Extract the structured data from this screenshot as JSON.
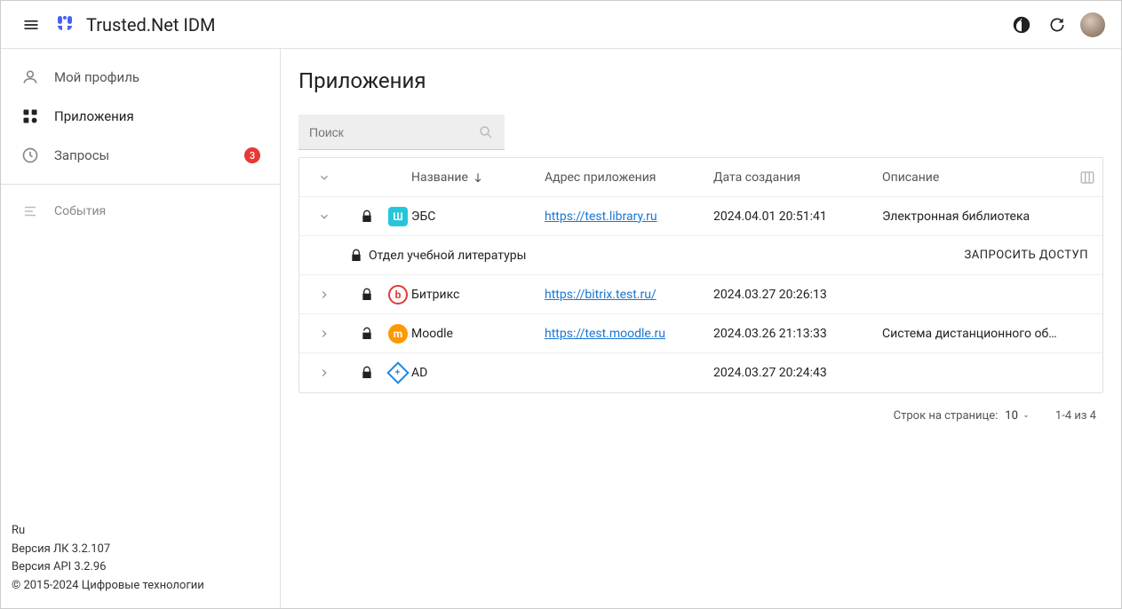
{
  "header": {
    "app_title": "Trusted.Net IDM"
  },
  "sidebar": {
    "items": [
      {
        "icon": "user-icon",
        "label": "Мой профиль"
      },
      {
        "icon": "apps-icon",
        "label": "Приложения",
        "active": true
      },
      {
        "icon": "clock-icon",
        "label": "Запросы",
        "badge": "3"
      }
    ],
    "events_label": "События",
    "footer": {
      "lang": "Ru",
      "version_lk": "Версия ЛК 3.2.107",
      "version_api": "Версия API 3.2.96",
      "copyright": "© 2015-2024 Цифровые технологии"
    }
  },
  "main": {
    "title": "Приложения",
    "search_placeholder": "Поиск",
    "columns": {
      "name": "Название",
      "url": "Адрес приложения",
      "created": "Дата создания",
      "desc": "Описание"
    },
    "rows": [
      {
        "expanded": true,
        "locked": true,
        "icon_color": "teal",
        "icon_glyph": "Ш",
        "name": "ЭБС",
        "url": "https://test.library.ru",
        "created": "2024.04.01 20:51:41",
        "desc": "Электронная библиотека",
        "sub": {
          "locked": true,
          "name": "Отдел учебной литературы",
          "action": "ЗАПРОСИТЬ ДОСТУП"
        }
      },
      {
        "expanded": false,
        "locked": true,
        "icon_color": "red",
        "icon_glyph": "b",
        "name": "Битрикс",
        "url": "https://bitrix.test.ru/",
        "created": "2024.03.27 20:26:13",
        "desc": ""
      },
      {
        "expanded": false,
        "locked": false,
        "icon_color": "orange",
        "icon_glyph": "m",
        "name": "Moodle",
        "url": "https://test.moodle.ru",
        "created": "2024.03.26 21:13:33",
        "desc": "Система дистанционного обу…"
      },
      {
        "expanded": false,
        "locked": true,
        "icon_color": "blue",
        "icon_glyph": "diamond",
        "name": "AD",
        "url": "",
        "created": "2024.03.27 20:24:43",
        "desc": ""
      }
    ],
    "pagination": {
      "label": "Строк на странице:",
      "per_page": "10",
      "range": "1-4 из 4"
    }
  }
}
